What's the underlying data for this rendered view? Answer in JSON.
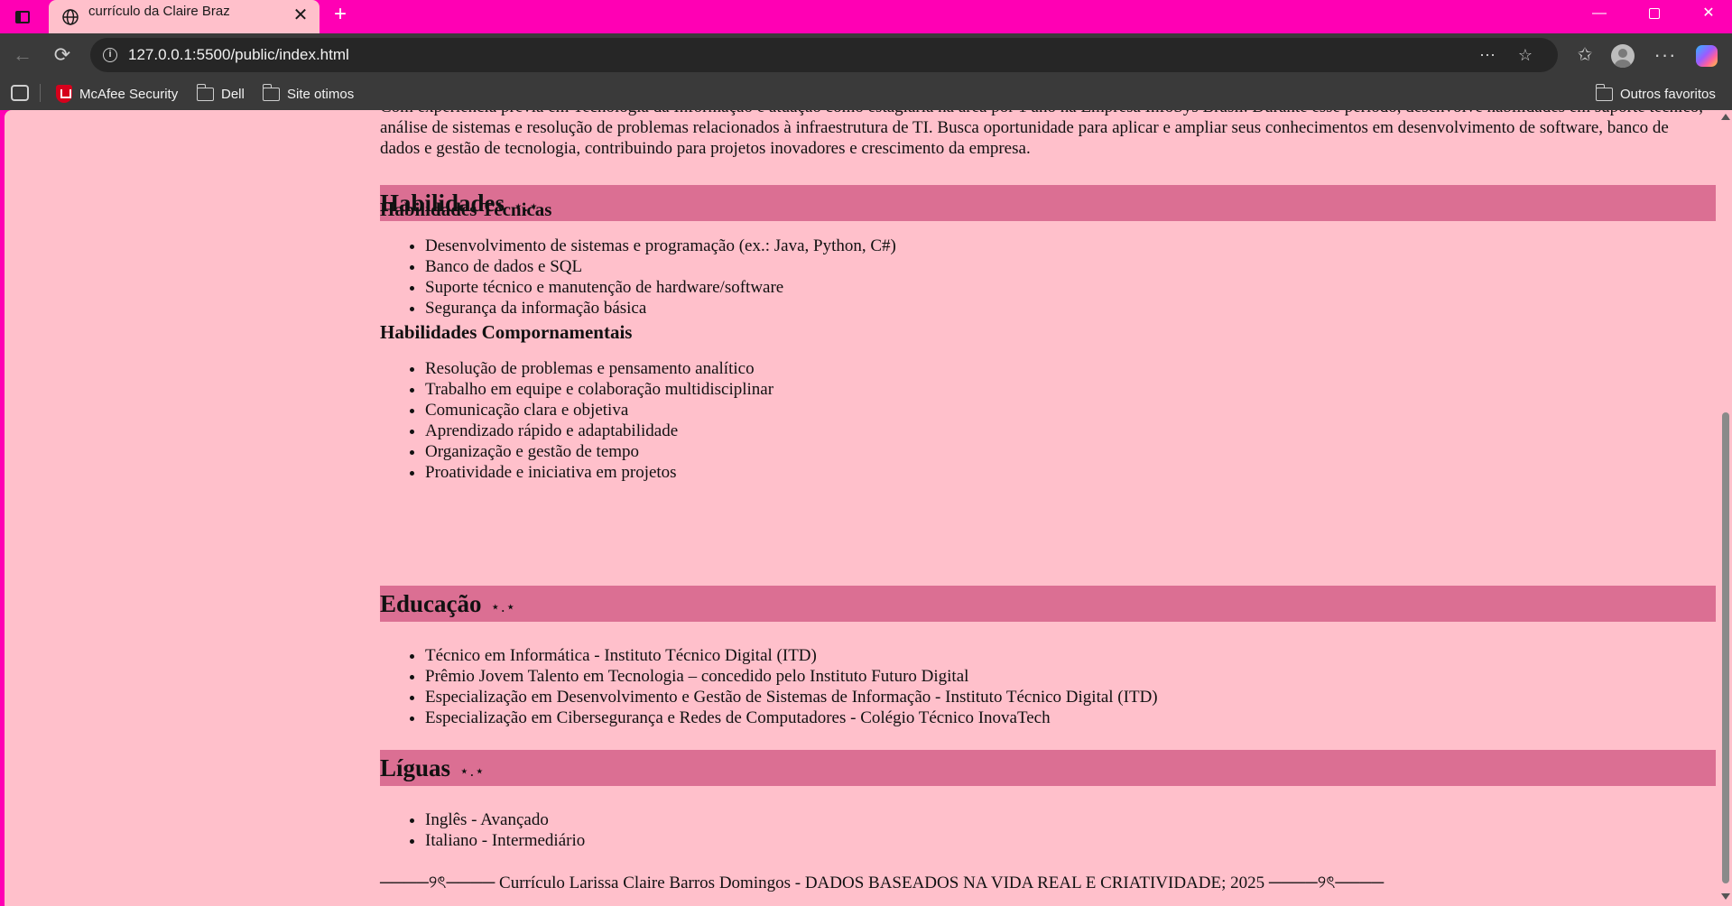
{
  "browser": {
    "tab_title": "currículo da Claire Braz",
    "close_glyph": "✕",
    "new_tab_glyph": "+",
    "url": "127.0.0.1:5500/public/index.html",
    "window": {
      "minimize": "—",
      "close": "✕"
    },
    "nav": {
      "back": "←",
      "reload": "⟳"
    },
    "icons": {
      "reader": "⋯",
      "star": "☆",
      "favorites": "✩",
      "menu": "···"
    }
  },
  "bookmarks": {
    "items": [
      "McAfee Security",
      "Dell",
      "Site otimos"
    ],
    "other": "Outros favoritos"
  },
  "page": {
    "intro": "Com experiência prévia em Tecnologia da Informação e atuação como estagiária na área por 1 ano na Empresa InfoSys Brasil. Durante esse período, desenvolve habilidades em suporte técnico, análise de sistemas e resolução de problemas relacionados à infraestrutura de TI. Busca oportunidade para aplicar e ampliar seus conhecimentos em desenvolvimento de software, banco de dados e gestão de tecnologia, contribuindo para projetos inovadores e crescimento da empresa.",
    "sparkle": "⋆.⋆",
    "skills": {
      "title": "Habilidades",
      "technical_title": "Habilidades Técnicas",
      "technical": [
        "Desenvolvimento de sistemas e programação (ex.: Java, Python, C#)",
        "Banco de dados e SQL",
        "Suporte técnico e manutenção de hardware/software",
        "Segurança da informação básica"
      ],
      "behavioral_title": "Habilidades Compornamentais",
      "behavioral": [
        "Resolução de problemas e pensamento analítico",
        "Trabalho em equipe e colaboração multidisciplinar",
        "Comunicação clara e objetiva",
        "Aprendizado rápido e adaptabilidade",
        "Organização e gestão de tempo",
        "Proatividade e iniciativa em projetos"
      ]
    },
    "education": {
      "title": "Educação",
      "items": [
        "Técnico em Informática - Instituto Técnico Digital (ITD)",
        "Prêmio Jovem Talento em Tecnologia – concedido pelo Instituto Futuro Digital",
        "Especialização em Desenvolvimento e Gestão de Sistemas de Informação - Instituto Técnico Digital (ITD)",
        "Especialização em Cibersegurança e Redes de Computadores - Colégio Técnico InovaTech"
      ]
    },
    "languages": {
      "title": "Líguas",
      "items": [
        "Inglês - Avançado",
        "Italiano - Intermediário"
      ]
    },
    "footer": "────୨ৎ──── Currículo Larissa Claire Barros Domingos - DADOS BASEADOS NA VIDA REAL E CRIATIVIDADE; 2025 ────୨ৎ────"
  }
}
